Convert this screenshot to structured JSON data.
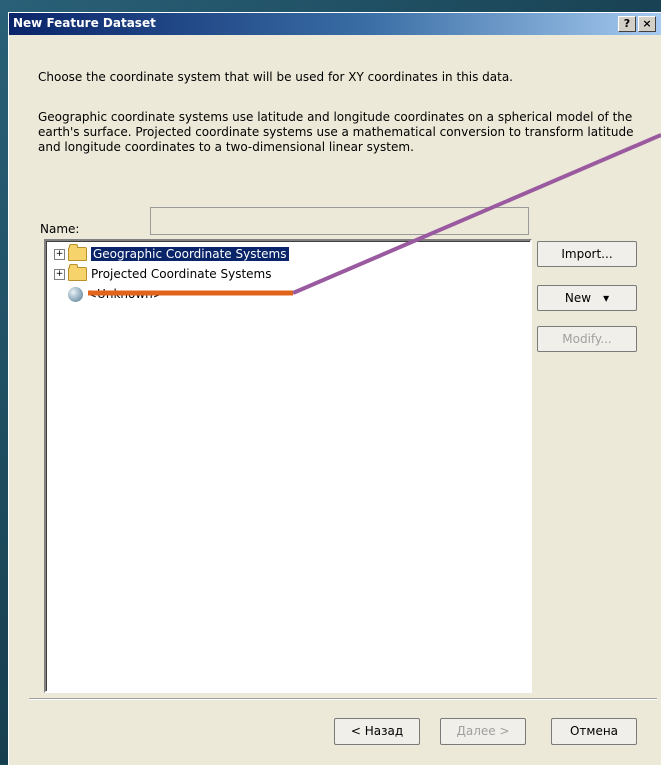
{
  "window": {
    "title": "New Feature Dataset",
    "help_glyph": "?",
    "close_glyph": "×"
  },
  "intro": {
    "line1": "Choose the coordinate system that will be used for XY coordinates in this data.",
    "line2": "Geographic coordinate systems use latitude and longitude coordinates on a spherical model of the earth's surface. Projected coordinate systems use a mathematical conversion to transform latitude and longitude coordinates to a two-dimensional linear system."
  },
  "name_field": {
    "label": "Name:",
    "value": ""
  },
  "tree": {
    "items": [
      {
        "label": "Geographic Coordinate Systems",
        "expander": "+",
        "icon": "folder-open-icon",
        "selected": true
      },
      {
        "label": "Projected Coordinate Systems",
        "expander": "+",
        "icon": "folder-icon",
        "selected": false
      },
      {
        "label": "<Unknown>",
        "icon": "globe-icon",
        "selected": false
      }
    ]
  },
  "side_buttons": {
    "import": "Import...",
    "new": "New",
    "new_caret": "▾",
    "modify": "Modify..."
  },
  "footer": {
    "back": "< Назад",
    "next": "Далее >",
    "cancel": "Отмена"
  },
  "colors": {
    "selection": "#0a246a",
    "annotation_orange": "#e0641a",
    "annotation_purple": "#9a5aa0"
  }
}
